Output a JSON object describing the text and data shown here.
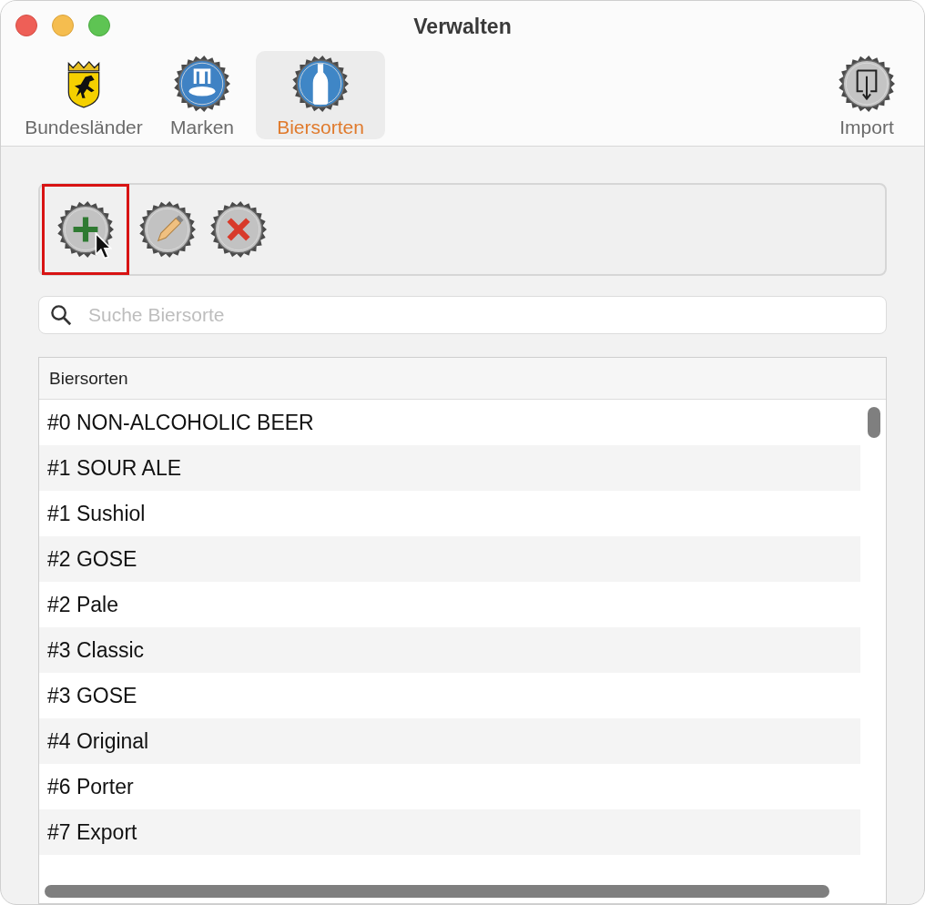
{
  "window": {
    "title": "Verwalten"
  },
  "toolbar": [
    {
      "kind": "shield",
      "label": "Bundesländer",
      "selected": false
    },
    {
      "kind": "brand-cap",
      "label": "Marken",
      "selected": false
    },
    {
      "kind": "bottle-cap",
      "label": "Biersorten",
      "selected": true
    },
    {
      "kind": "import-cap",
      "label": "Import",
      "selected": false
    }
  ],
  "actions": [
    {
      "kind": "add",
      "highlighted": true
    },
    {
      "kind": "edit",
      "highlighted": false
    },
    {
      "kind": "delete",
      "highlighted": false
    }
  ],
  "search": {
    "placeholder": "Suche Biersorte"
  },
  "table": {
    "columns": [
      "Biersorten"
    ],
    "rows": [
      "#0 NON-ALCOHOLIC BEER",
      "#1 SOUR ALE",
      "#1 Sushiol",
      "#2 GOSE",
      "#2 Pale",
      "#3 Classic",
      "#3 GOSE",
      "#4 Original",
      "#6 Porter",
      "#7 Export"
    ]
  }
}
